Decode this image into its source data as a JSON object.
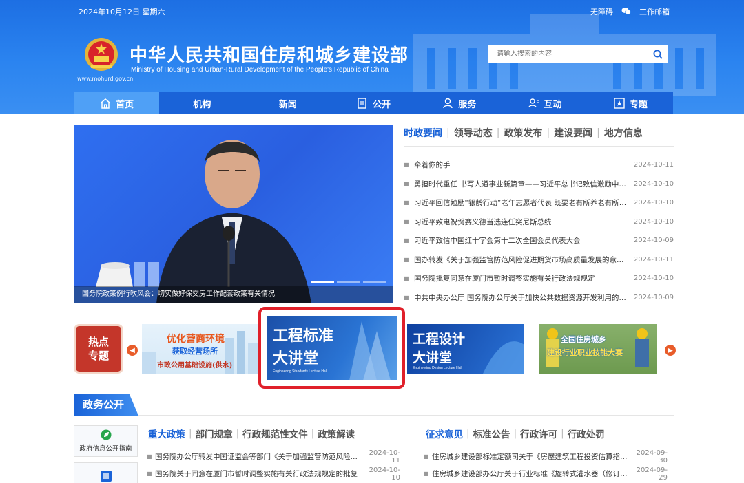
{
  "header": {
    "date": "2024年10月12日 星期六",
    "links": [
      "无障碍",
      "工作邮箱"
    ],
    "site_title": "中华人民共和国住房和城乡建设部",
    "site_subtitle": "Ministry of Housing and Urban-Rural Development of the People's Republic of China",
    "site_url": "www.mohurd.gov.cn",
    "search_placeholder": "请输入搜索的内容"
  },
  "nav": {
    "items": [
      {
        "label": "首页",
        "icon": "home-icon"
      },
      {
        "label": "机构",
        "icon": ""
      },
      {
        "label": "新闻",
        "icon": ""
      },
      {
        "label": "公开",
        "icon": "document-icon"
      },
      {
        "label": "服务",
        "icon": "person-service-icon"
      },
      {
        "label": "互动",
        "icon": "interaction-icon"
      },
      {
        "label": "专题",
        "icon": "star-box-icon"
      }
    ]
  },
  "hero": {
    "caption": "国务院政策例行吹风会：切实做好保交房工作配套政策有关情况"
  },
  "news": {
    "tabs": [
      "时政要闻",
      "领导动态",
      "政策发布",
      "建设要闻",
      "地方信息"
    ],
    "items": [
      {
        "title": "牵着你的手",
        "date": "2024-10-11"
      },
      {
        "title": "勇担时代重任 书写人道事业新篇章——习近平总书记致信激励中国红十字会...",
        "date": "2024-10-10"
      },
      {
        "title": "习近平回信勉励“银龄行动”老年志愿者代表 既要老有所养老有所为...",
        "date": "2024-10-10"
      },
      {
        "title": "习近平致电祝贺赛义德当选连任突尼斯总统",
        "date": "2024-10-10"
      },
      {
        "title": "习近平致信中国红十字会第十二次全国会员代表大会",
        "date": "2024-10-09"
      },
      {
        "title": "国办转发《关于加强监管防范风险促进期货市场高质量发展的意见》",
        "date": "2024-10-11"
      },
      {
        "title": "国务院批复同意在厦门市暂时调整实施有关行政法规规定",
        "date": "2024-10-10"
      },
      {
        "title": "中共中央办公厅 国务院办公厅关于加快公共数据资源开发利用的意见",
        "date": "2024-10-09"
      }
    ]
  },
  "topics": {
    "hot_line1": "热点",
    "hot_line2": "专题",
    "b1_line1": "优化营商环境",
    "b1_line2": "获取经营场所",
    "b1_line3": "市政公用基础设施(供水)",
    "b2_line1": "工程标准",
    "b2_line2": "大讲堂",
    "b2_en": "Engineering Standards Lecture Hall",
    "b3_line1": "工程设计",
    "b3_line2": "大讲堂",
    "b3_en": "Engineering Design Lecture Hall",
    "b4_line1": "全国住房城乡",
    "b4_line2": "建设行业职业技能大赛"
  },
  "gov": {
    "section_title": "政务公开",
    "side_card_label": "政府信息公开指南",
    "left_tabs": [
      "重大政策",
      "部门规章",
      "行政规范性文件",
      "政策解读"
    ],
    "right_tabs": [
      "征求意见",
      "标准公告",
      "行政许可",
      "行政处罚"
    ],
    "left_items": [
      {
        "title": "国务院办公厅转发中国证监会等部门《关于加强监管防范风险促进期货市场高质量发展的意见》",
        "date": "2024-10-11"
      },
      {
        "title": "国务院关于同意在厦门市暂时调整实施有关行政法规规定的批复",
        "date": "2024-10-10"
      }
    ],
    "right_items": [
      {
        "title": "住房城乡建设部标准定额司关于《房屋建筑工程投资估算指标》征求意见的函",
        "date": "2024-09-30"
      },
      {
        "title": "住房城乡建设部办公厅关于行业标准《旋转式灌水器（修订）》征求意见的函",
        "date": "2024-09-29"
      }
    ]
  }
}
